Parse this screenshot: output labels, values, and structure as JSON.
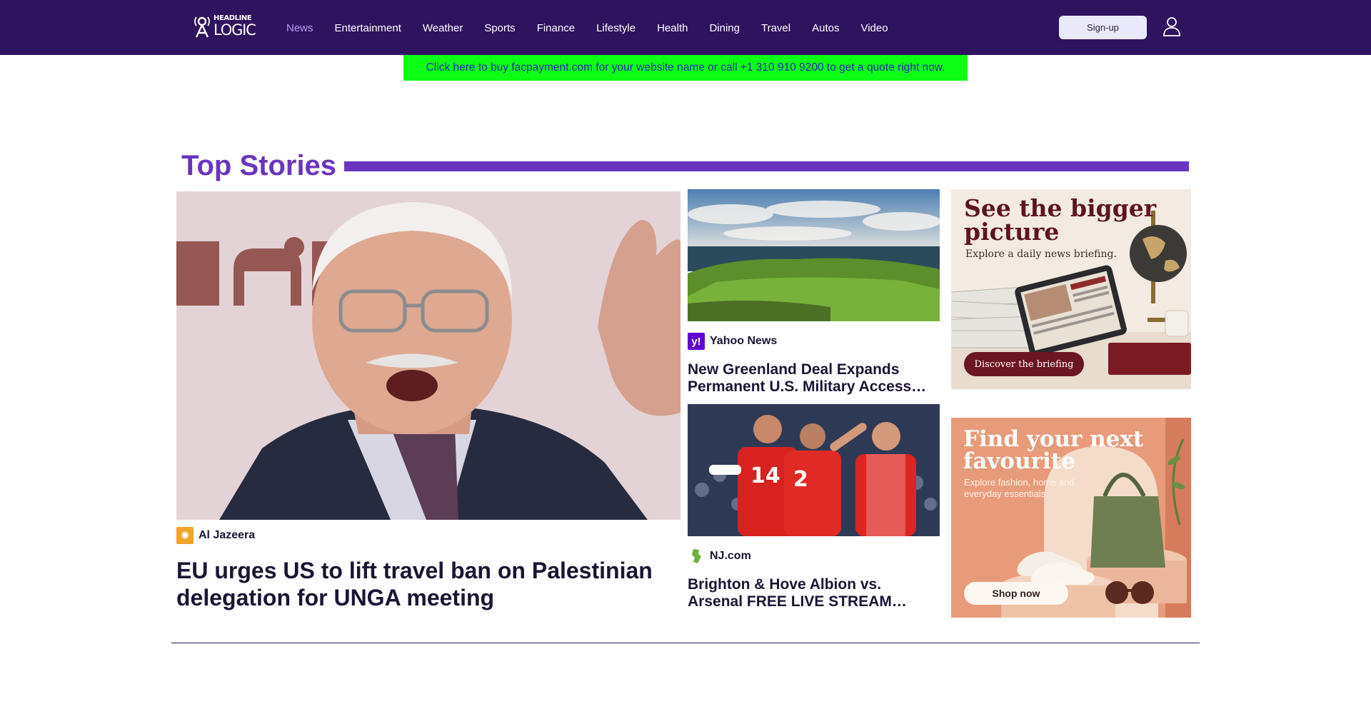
{
  "brand": {
    "logo_top": "HEADLINE",
    "logo_bottom": "LOGIC"
  },
  "nav": {
    "items": [
      {
        "label": "News",
        "active": true
      },
      {
        "label": "Entertainment"
      },
      {
        "label": "Weather"
      },
      {
        "label": "Sports"
      },
      {
        "label": "Finance"
      },
      {
        "label": "Lifestyle"
      },
      {
        "label": "Health"
      },
      {
        "label": "Dining"
      },
      {
        "label": "Travel"
      },
      {
        "label": "Autos"
      },
      {
        "label": "Video"
      }
    ],
    "signup_label": "Sign-up",
    "user_icon": "user-icon"
  },
  "promo": {
    "text": "Click here to buy facpayment.com for your website name or call +1 310 910 9200 to get a quote right now.",
    "background": "#0cff14",
    "text_color": "#1d2aa8"
  },
  "section": {
    "title": "Top Stories",
    "accent": "#6a35be"
  },
  "stories": {
    "main": {
      "source": "Al Jazeera",
      "source_icon": "al-jazeera-logo-icon",
      "headline": "EU urges US to lift travel ban on Palestinian delegation for UNGA meeting"
    },
    "second": {
      "source": "Yahoo News",
      "source_icon": "yahoo-logo-icon",
      "headline": "New Greenland Deal Expands Permanent U.S. Military Access…"
    },
    "third": {
      "source": "NJ.com",
      "source_icon": "nj-logo-icon",
      "headline": "Brighton & Hove Albion vs. Arsenal FREE LIVE STREAM…"
    }
  },
  "ads": {
    "briefing": {
      "heading_line1": "See the bigger",
      "heading_line2": "picture",
      "sub": "Explore a daily news briefing.",
      "cta": "Discover the briefing"
    },
    "shopping": {
      "heading_line1": "Find your next",
      "heading_line2": "favourite",
      "sub_line1": "Explore fashion, home and",
      "sub_line2": "everyday essentials.",
      "cta": "Shop now"
    }
  },
  "colors": {
    "nav_bg": "#2f135f",
    "nav_active": "#b39df0",
    "headline": "#1c1433"
  }
}
